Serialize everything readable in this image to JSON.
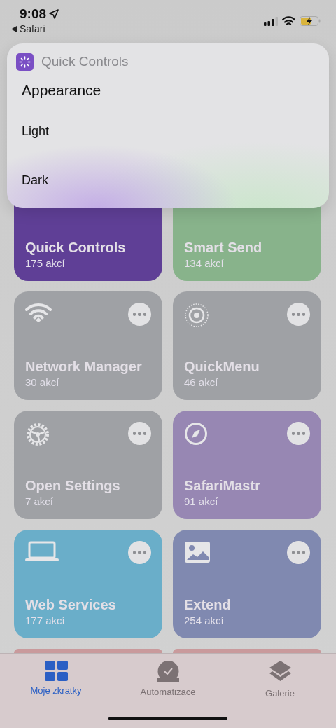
{
  "status_bar": {
    "time": "9:08",
    "back_app": "Safari"
  },
  "popup": {
    "app_name": "Quick Controls",
    "title": "Appearance",
    "options": [
      {
        "label": "Light"
      },
      {
        "label": "Dark"
      }
    ]
  },
  "shortcuts": [
    {
      "title": "Quick Controls",
      "count": "175 akcí",
      "color": "#5f3f96",
      "kind": "covered"
    },
    {
      "title": "Smart Send",
      "count": "134 akcí",
      "color": "#88b38b",
      "kind": "covered"
    },
    {
      "title": "Network Manager",
      "count": "30 akcí",
      "color": "#9fa1a5",
      "kind": "full"
    },
    {
      "title": "QuickMenu",
      "count": "46 akcí",
      "color": "#9fa1a5",
      "kind": "full"
    },
    {
      "title": "Open Settings",
      "count": "7 akcí",
      "color": "#9fa1a5",
      "kind": "full"
    },
    {
      "title": "SafariMastr",
      "count": "91 akcí",
      "color": "#9787b3",
      "kind": "full"
    },
    {
      "title": "Web Services",
      "count": "177 akcí",
      "color": "#6aaec9",
      "kind": "full"
    },
    {
      "title": "Extend",
      "count": "254 akcí",
      "color": "#8089b0",
      "kind": "full"
    },
    {
      "color": "#c99a9c",
      "kind": "partial"
    },
    {
      "color": "#c99a9c",
      "kind": "partial"
    }
  ],
  "tab_bar": [
    {
      "label": "Moje zkratky",
      "selected": true
    },
    {
      "label": "Automatizace",
      "selected": false
    },
    {
      "label": "Galerie",
      "selected": false
    }
  ]
}
